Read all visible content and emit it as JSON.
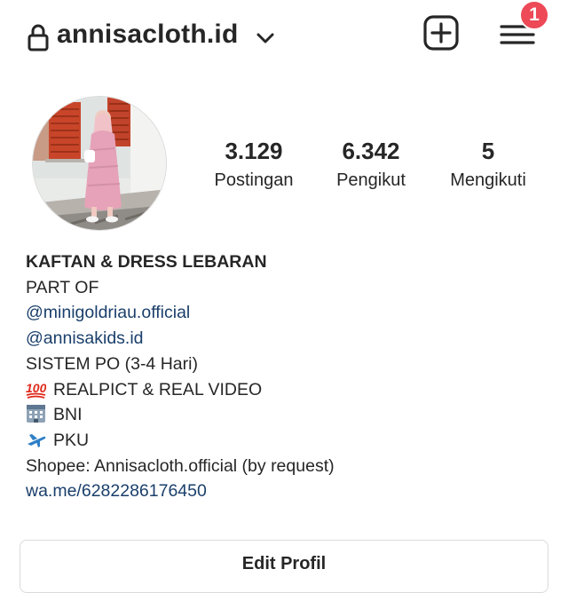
{
  "header": {
    "username": "annisacloth.id",
    "notification_count": "1",
    "icons": {
      "lock": "lock-icon",
      "dropdown": "chevron-down-icon",
      "new_post": "plus-square-icon",
      "menu": "hamburger-menu-icon"
    }
  },
  "profile": {
    "avatar": "profile-photo",
    "stats": [
      {
        "value": "3.129",
        "label": "Postingan"
      },
      {
        "value": "6.342",
        "label": "Pengikut"
      },
      {
        "value": "5",
        "label": "Mengikuti"
      }
    ]
  },
  "bio": {
    "name": "KAFTAN & DRESS LEBARAN",
    "line1": "PART OF",
    "mention1": "@minigoldriau.official",
    "mention2": "@annisakids.id",
    "line2": "SISTEM PO (3-4 Hari)",
    "line3": "REALPICT & REAL VIDEO",
    "line4": "BNI",
    "line5": "PKU",
    "line6": "Shopee: Annisacloth.official (by request)",
    "website": "wa.me/6282286176450",
    "emoji_icons": [
      "hundred-points-emoji",
      "bank-emoji",
      "airplane-departure-emoji"
    ]
  },
  "actions": {
    "edit_profile": "Edit Profil"
  },
  "colors": {
    "badge": "#ed4956",
    "link": "#1a3f6b",
    "text": "#262626",
    "border": "#dbdbdb"
  }
}
